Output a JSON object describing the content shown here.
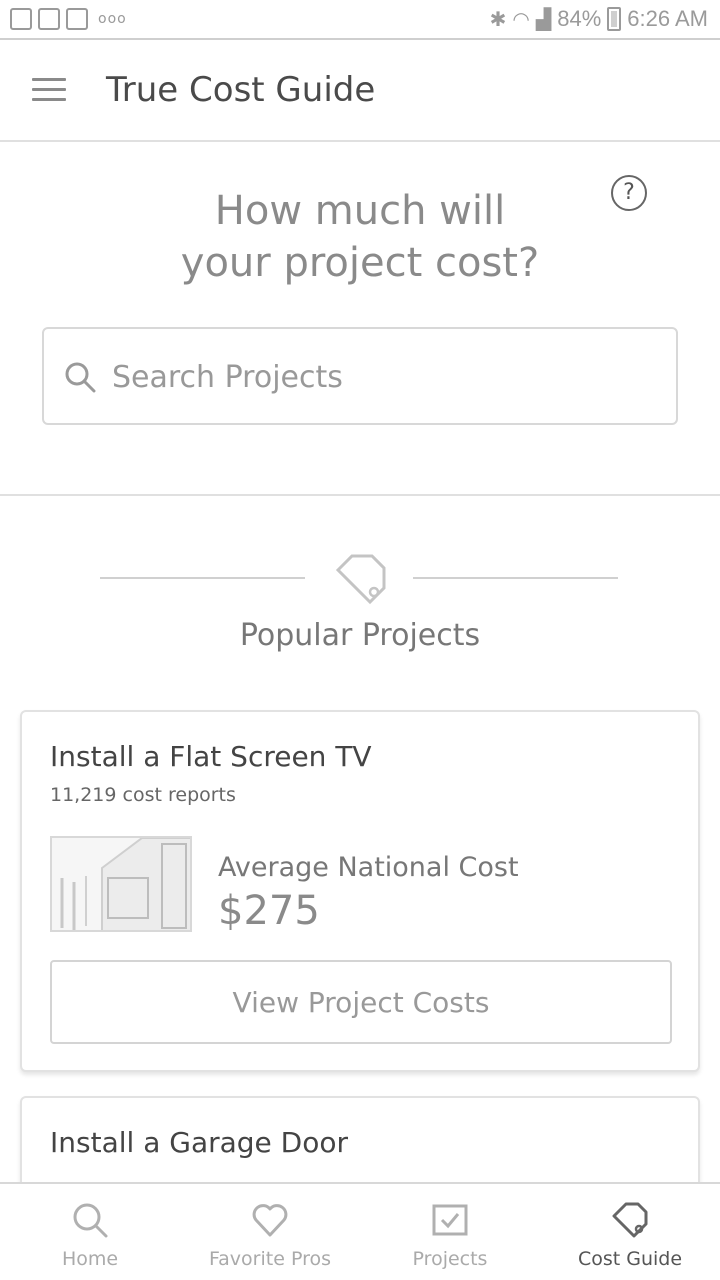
{
  "status_bar": {
    "battery": "84%",
    "time": "6:26 AM",
    "overflow": "ooo"
  },
  "app_bar": {
    "title": "True Cost Guide",
    "menu_icon": "hamburger-menu-icon"
  },
  "hero": {
    "title_line1": "How much will",
    "title_line2": "your project cost?",
    "help_icon": "help-circle-icon",
    "help_glyph": "?"
  },
  "search": {
    "placeholder": "Search Projects",
    "icon": "search-icon"
  },
  "popular": {
    "title": "Popular Projects",
    "icon": "tag-icon"
  },
  "projects": [
    {
      "title": "Install a Flat Screen TV",
      "reports": "11,219 cost reports",
      "avg_label": "Average National Cost",
      "avg_value": "$275",
      "button_label": "View Project Costs"
    },
    {
      "title": "Install a Garage Door"
    }
  ],
  "bottom_nav": {
    "items": [
      {
        "label": "Home",
        "icon": "search-icon"
      },
      {
        "label": "Favorite Pros",
        "icon": "heart-icon"
      },
      {
        "label": "Projects",
        "icon": "checklist-icon"
      },
      {
        "label": "Cost Guide",
        "icon": "tag-icon"
      }
    ],
    "active": "Cost Guide"
  },
  "colors": {
    "text_dark": "#444444",
    "text_muted": "#999999",
    "border": "#d8d8d8",
    "background": "#ffffff"
  }
}
